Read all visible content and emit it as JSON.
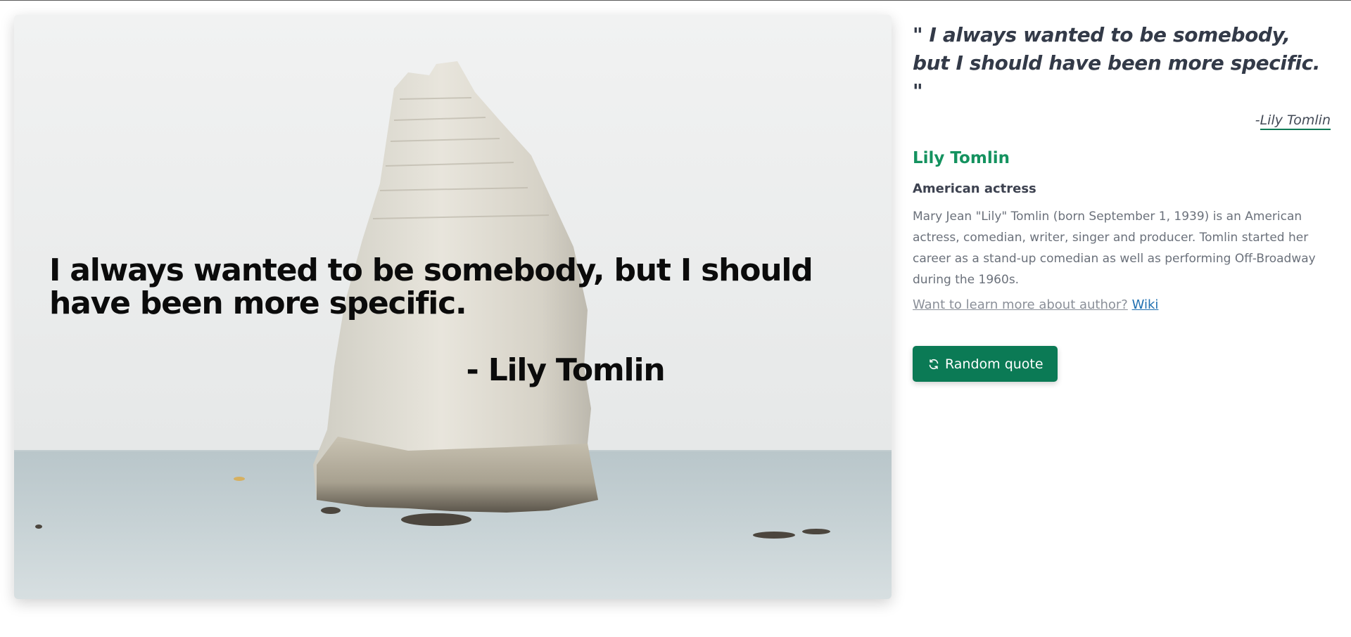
{
  "image_card": {
    "quote_text": "I always wanted to be somebody, but I should have been more specific.",
    "author_text": "- Lily Tomlin"
  },
  "sidebar": {
    "quote": "\" I always wanted to be somebody, but I should have been more specific. \"",
    "attribution_dash": "-",
    "attribution_name": "Lily Tomlin",
    "author_name": "Lily Tomlin",
    "author_role": "American actress",
    "author_bio": "Mary Jean \"Lily\" Tomlin (born September 1, 1939) is an American actress, comedian, writer, singer and producer. Tomlin started her career as a stand-up comedian as well as performing Off-Broadway during the 1960s.",
    "learn_more_prompt": "Want to learn more about author?",
    "wiki_link": "Wiki",
    "random_button_label": "Random quote",
    "random_button_icon": "refresh-icon"
  },
  "colors": {
    "accent_green": "#0b7a55",
    "author_name_green": "#14925f",
    "link_blue": "#1f6fb0",
    "quote_text": "#333a48"
  }
}
